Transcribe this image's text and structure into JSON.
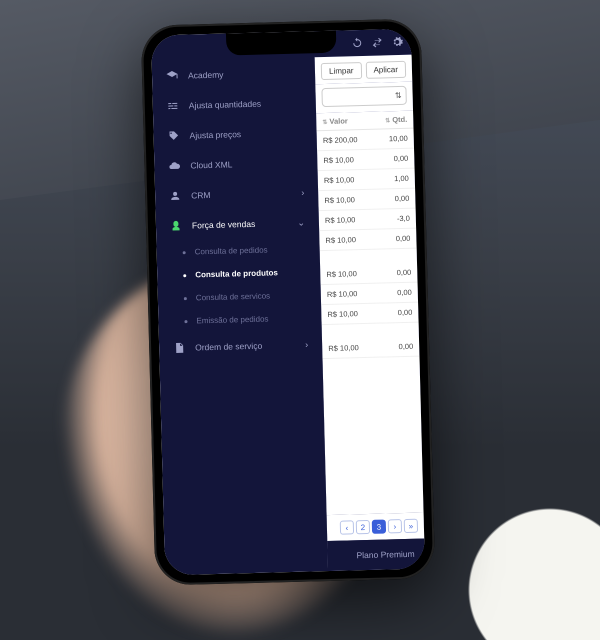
{
  "topbar": {
    "icons": [
      "refresh-icon",
      "transfer-icon",
      "settings-icon"
    ]
  },
  "menu": [
    {
      "icon": "academy-icon",
      "label": "Academy"
    },
    {
      "icon": "sliders-icon",
      "label": "Ajusta quantidades"
    },
    {
      "icon": "tag-icon",
      "label": "Ajusta preços"
    },
    {
      "icon": "cloud-icon",
      "label": "Cloud XML"
    },
    {
      "icon": "person-icon",
      "label": "CRM",
      "expandable": true
    },
    {
      "icon": "handshake-icon",
      "label": "Força de vendas",
      "expandable": true,
      "expanded": true,
      "green": true,
      "children": [
        {
          "label": "Consulta de pedidos"
        },
        {
          "label": "Consulta de produtos",
          "active": true
        },
        {
          "label": "Consulta de servicos"
        },
        {
          "label": "Emissão de pedidos"
        }
      ]
    },
    {
      "icon": "doc-icon",
      "label": "Ordem de serviço",
      "expandable": true
    }
  ],
  "actions": {
    "clear": "Limpar",
    "apply": "Aplicar"
  },
  "table": {
    "headers": {
      "value": "Valor",
      "qty": "Qtd."
    },
    "rows": [
      {
        "value": "R$ 200,00",
        "qty": "10,00"
      },
      {
        "value": "R$ 10,00",
        "qty": "0,00"
      },
      {
        "value": "R$ 10,00",
        "qty": "1,00"
      },
      {
        "value": "R$ 10,00",
        "qty": "0,00"
      },
      {
        "value": "R$ 10,00",
        "qty": "-3,0"
      },
      {
        "value": "R$ 10,00",
        "qty": "0,00"
      },
      {
        "value": "R$ 10,00",
        "qty": "0,00"
      },
      {
        "value": "R$ 10,00",
        "qty": "0,00"
      },
      {
        "value": "R$ 10,00",
        "qty": "0,00"
      },
      {
        "value": "R$ 10,00",
        "qty": "0,00"
      }
    ]
  },
  "pagination": {
    "pages": [
      "‹",
      "2",
      "3",
      "›",
      "»"
    ],
    "active": "3"
  },
  "footer": {
    "plan": "Plano Premium"
  }
}
